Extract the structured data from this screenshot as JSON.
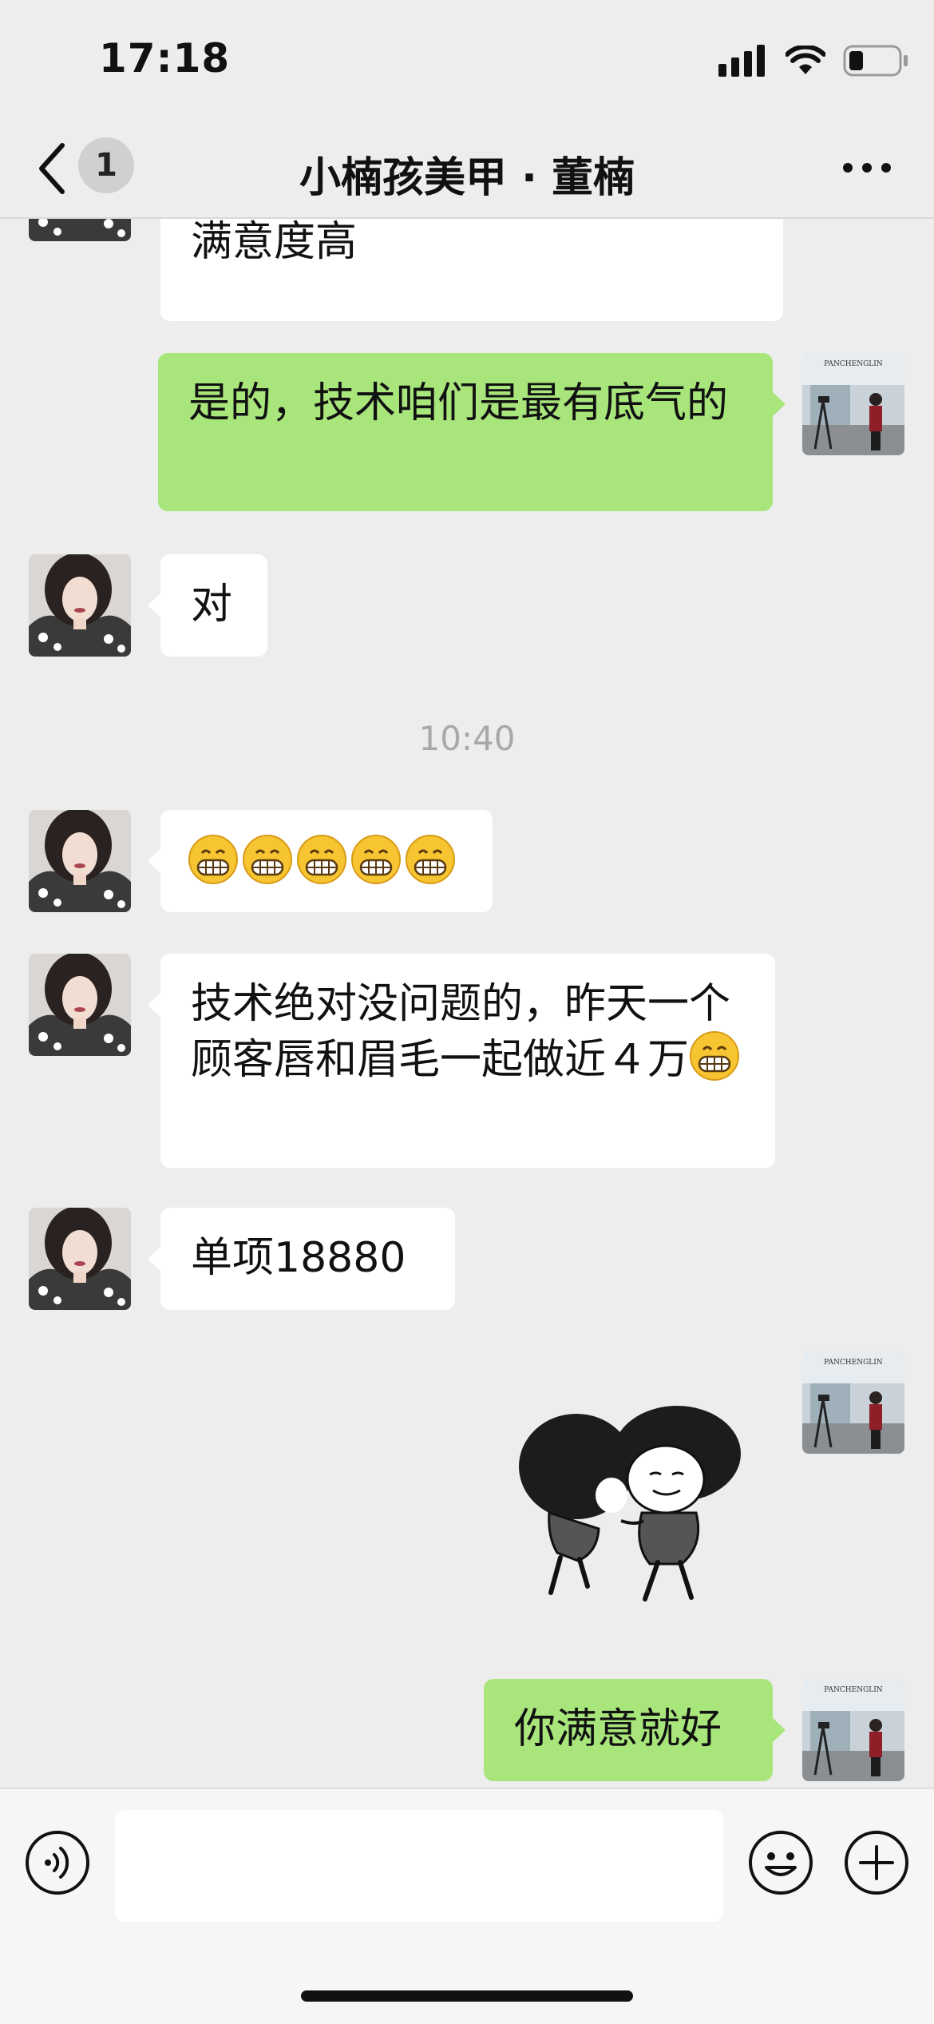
{
  "status_bar": {
    "time": "17:18",
    "battery_level": 0.3
  },
  "nav": {
    "back_icon": "chevron-left-icon",
    "unread_count": "1",
    "title": "小楠孩美甲 · 董楠",
    "more_icon": "more-dots-icon"
  },
  "messages": [
    {
      "side": "in",
      "text": "咱PCL的技术很厉害的，顾客满意度高"
    },
    {
      "side": "out",
      "text": "是的，技术咱们是最有底气的"
    },
    {
      "side": "in",
      "text": "对"
    },
    {
      "type": "time",
      "text": "10:40"
    },
    {
      "side": "in",
      "emoji": "grinning-face-emoji",
      "emoji_count": 5
    },
    {
      "side": "in",
      "text": "技术绝对没问题的，昨天一个顾客唇和眉毛一起做近４万",
      "emoji": "grinning-face-emoji"
    },
    {
      "side": "in",
      "text": "单项18880"
    },
    {
      "side": "out",
      "type": "sticker",
      "sticker": "mushroom-head-hug-sticker"
    },
    {
      "side": "out",
      "text": "你满意就好"
    }
  ],
  "input_bar": {
    "voice_icon": "voice-icon",
    "emoji_icon": "smiley-icon",
    "plus_icon": "plus-circle-icon"
  },
  "colors": {
    "background": "#ededed",
    "outgoing_bubble": "#a8e67c",
    "incoming_bubble": "#ffffff"
  }
}
